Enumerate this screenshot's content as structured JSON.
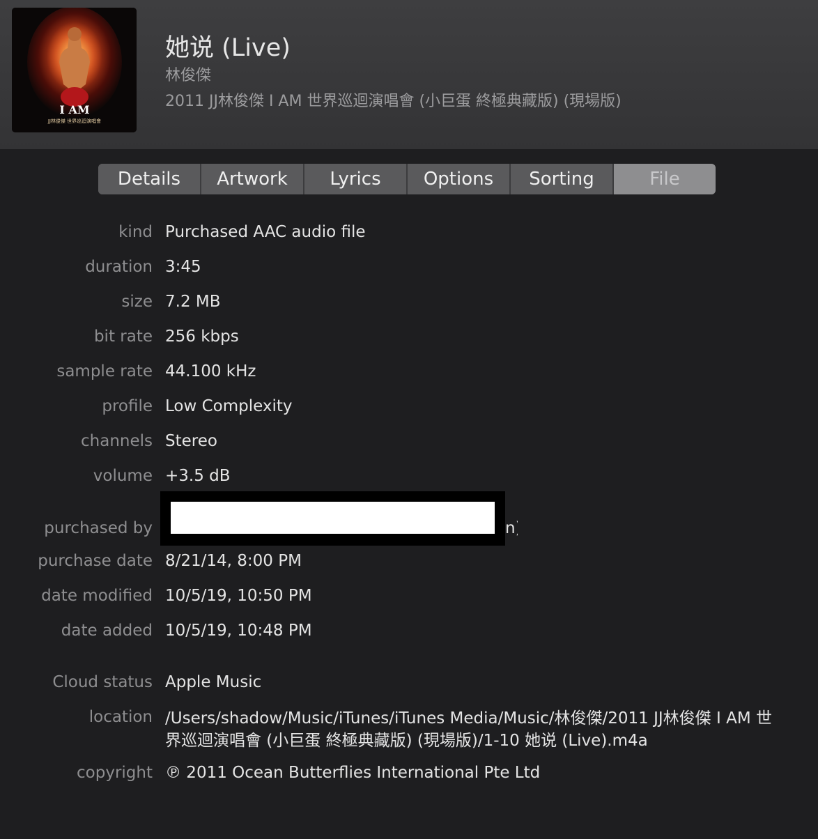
{
  "header": {
    "title": "她说 (Live)",
    "artist": "林俊傑",
    "album": "2011 JJ林俊傑 I AM 世界巡迴演唱會 (小巨蛋 終極典藏版) (現場版)",
    "artwork": {
      "title_text": "I AM",
      "subtitle_text": "JJ林俊傑 世界巡迴演唱會"
    }
  },
  "tabs": [
    {
      "label": "Details",
      "selected": false
    },
    {
      "label": "Artwork",
      "selected": false
    },
    {
      "label": "Lyrics",
      "selected": false
    },
    {
      "label": "Options",
      "selected": false
    },
    {
      "label": "Sorting",
      "selected": false
    },
    {
      "label": "File",
      "selected": true
    }
  ],
  "fields": {
    "kind": {
      "label": "kind",
      "value": "Purchased AAC audio file"
    },
    "duration": {
      "label": "duration",
      "value": "3:45"
    },
    "size": {
      "label": "size",
      "value": "7.2 MB"
    },
    "bit_rate": {
      "label": "bit rate",
      "value": "256 kbps"
    },
    "sample_rate": {
      "label": "sample rate",
      "value": "44.100 kHz"
    },
    "profile": {
      "label": "profile",
      "value": "Low Complexity"
    },
    "channels": {
      "label": "channels",
      "value": "Stereo"
    },
    "volume": {
      "label": "volume",
      "value": "+3.5 dB"
    },
    "purchased_by": {
      "label": "purchased by",
      "value_tail": "n)"
    },
    "purchase_date": {
      "label": "purchase date",
      "value": "8/21/14, 8:00 PM"
    },
    "date_modified": {
      "label": "date modified",
      "value": "10/5/19, 10:50 PM"
    },
    "date_added": {
      "label": "date added",
      "value": "10/5/19, 10:48 PM"
    },
    "cloud_status": {
      "label": "Cloud status",
      "value": "Apple Music"
    },
    "location": {
      "label": "location",
      "value": "/Users/shadow/Music/iTunes/iTunes Media/Music/林俊傑/2011 JJ林俊傑 I AM 世界巡迴演唱會 (小巨蛋 終極典藏版) (現場版)/1-10 她说 (Live).m4a"
    },
    "copyright": {
      "label": "copyright",
      "value": "℗ 2011 Ocean Butterflies International Pte Ltd"
    }
  }
}
